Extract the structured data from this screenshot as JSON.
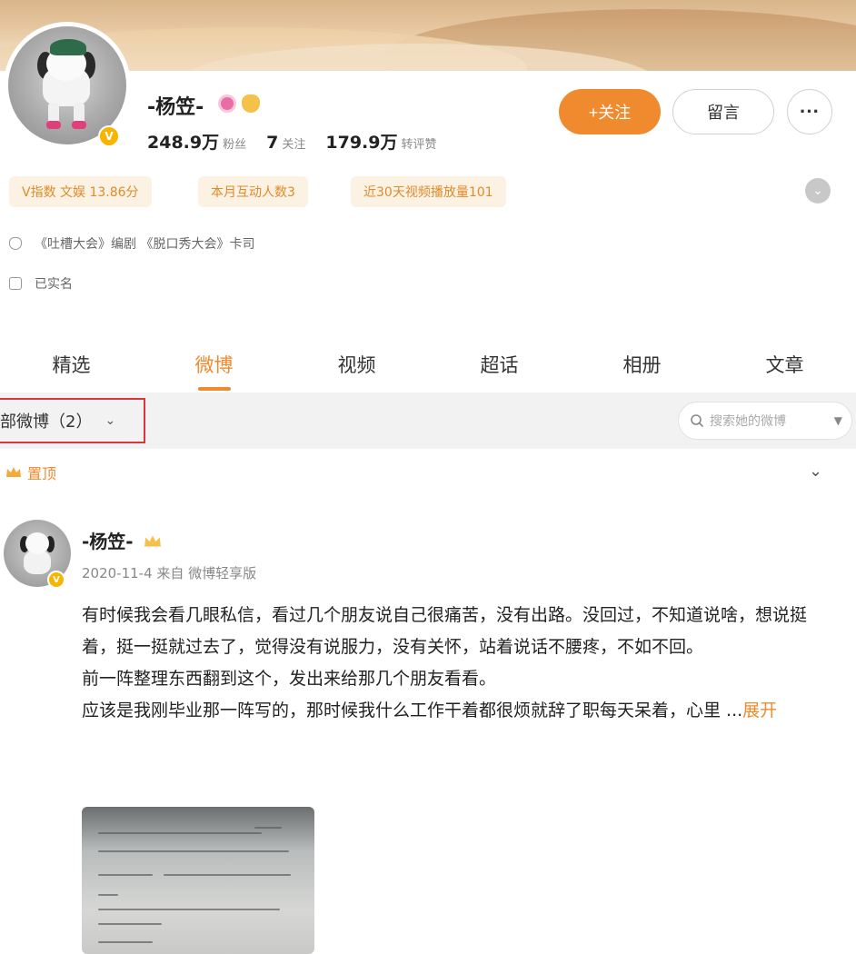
{
  "profile": {
    "name": "-杨笠-",
    "verified_badge": "V",
    "stats": {
      "fans_value": "248.9万",
      "fans_label": "粉丝",
      "following_value": "7",
      "following_label": "关注",
      "likes_value": "179.9万",
      "likes_label": "转评赞"
    },
    "actions": {
      "follow_label": "+关注",
      "message_label": "留言",
      "more_label": "···"
    },
    "tags": [
      "V指数 文娱 13.86分",
      "本月互动人数3",
      "近30天视频播放量101"
    ],
    "info": [
      {
        "icon": "shield-icon",
        "text": "《吐槽大会》编剧 《脱口秀大会》卡司"
      },
      {
        "icon": "id-card-icon",
        "text": "已实名"
      }
    ]
  },
  "tabs": [
    "精选",
    "微博",
    "视频",
    "超话",
    "相册",
    "文章"
  ],
  "active_tab": "微博",
  "filter": {
    "label": "部微博（2）",
    "search_placeholder": "搜索她的微博"
  },
  "pinned_label": "置顶",
  "post": {
    "author": "-杨笠-",
    "meta": "2020-11-4 来自 微博轻享版",
    "paragraphs": [
      "有时候我会看几眼私信，看过几个朋友说自己很痛苦，没有出路。没回过，不知道说啥，想说挺着，挺一挺就过去了，觉得没有说服力，没有关怀，站着说话不腰疼，不如不回。",
      "前一阵整理东西翻到这个，发出来给那几个朋友看看。"
    ],
    "last_paragraph": "应该是我刚毕业那一阵写的，那时候我什么工作干着都很烦就辞了职每天呆着，心里 ...",
    "expand_label": "展开"
  },
  "colors": {
    "accent": "#f08a2e",
    "highlight_border": "#d9363e",
    "tag_bg": "#fbf2e4"
  }
}
